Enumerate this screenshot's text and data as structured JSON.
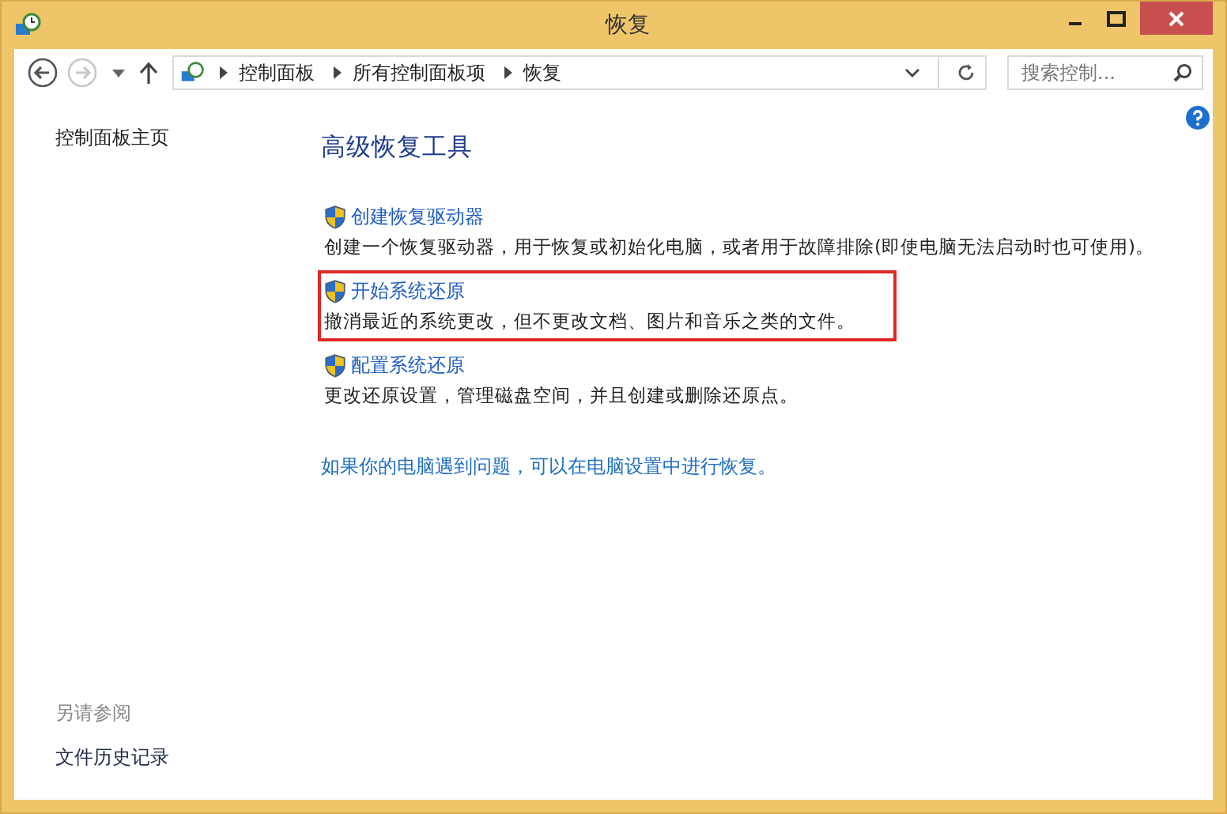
{
  "window": {
    "title": "恢复"
  },
  "nav_buttons": [
    {
      "kind": "back",
      "disabled": false
    },
    {
      "kind": "forward",
      "disabled": true
    }
  ],
  "address_bar": {
    "path": [
      "控制面板",
      "所有控制面板项",
      "恢复"
    ]
  },
  "search": {
    "placeholder": "搜索控制..."
  },
  "sidebar": {
    "home_link": "控制面板主页",
    "see_also_heading": "另请参阅",
    "see_also_links": [
      "文件历史记录"
    ]
  },
  "main": {
    "heading": "高级恢复工具",
    "tasks": [
      {
        "title": "创建恢复驱动器",
        "description": "创建一个恢复驱动器，用于恢复或初始化电脑，或者用于故障排除(即使电脑无法启动时也可使用)。",
        "highlighted": false
      },
      {
        "title": "开始系统还原",
        "description": "撤消最近的系统更改，但不更改文档、图片和音乐之类的文件。",
        "highlighted": true
      },
      {
        "title": "配置系统还原",
        "description": "更改还原设置，管理磁盘空间，并且创建或删除还原点。",
        "highlighted": false
      }
    ],
    "footer_link": "如果你的电脑遇到问题，可以在电脑设置中进行恢复。"
  }
}
